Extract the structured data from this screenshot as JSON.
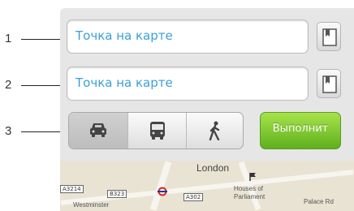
{
  "callouts": [
    "1",
    "2",
    "3"
  ],
  "route": {
    "from_value": "Точка на карте",
    "to_value": "Точка на карте"
  },
  "modes": [
    {
      "name": "car",
      "icon": "car-icon",
      "selected": true
    },
    {
      "name": "transit",
      "icon": "bus-icon",
      "selected": false
    },
    {
      "name": "walking",
      "icon": "walking-icon",
      "selected": false
    }
  ],
  "go_button": "Выполнит",
  "map": {
    "labels": [
      "London",
      "Houses of",
      "Parliament",
      "Westminster",
      "Palace Rd"
    ],
    "road_badges": [
      "A3214",
      "B323",
      "A302"
    ]
  },
  "colors": {
    "field_text": "#3aa0d8",
    "go_button": "#7ccb2f"
  }
}
